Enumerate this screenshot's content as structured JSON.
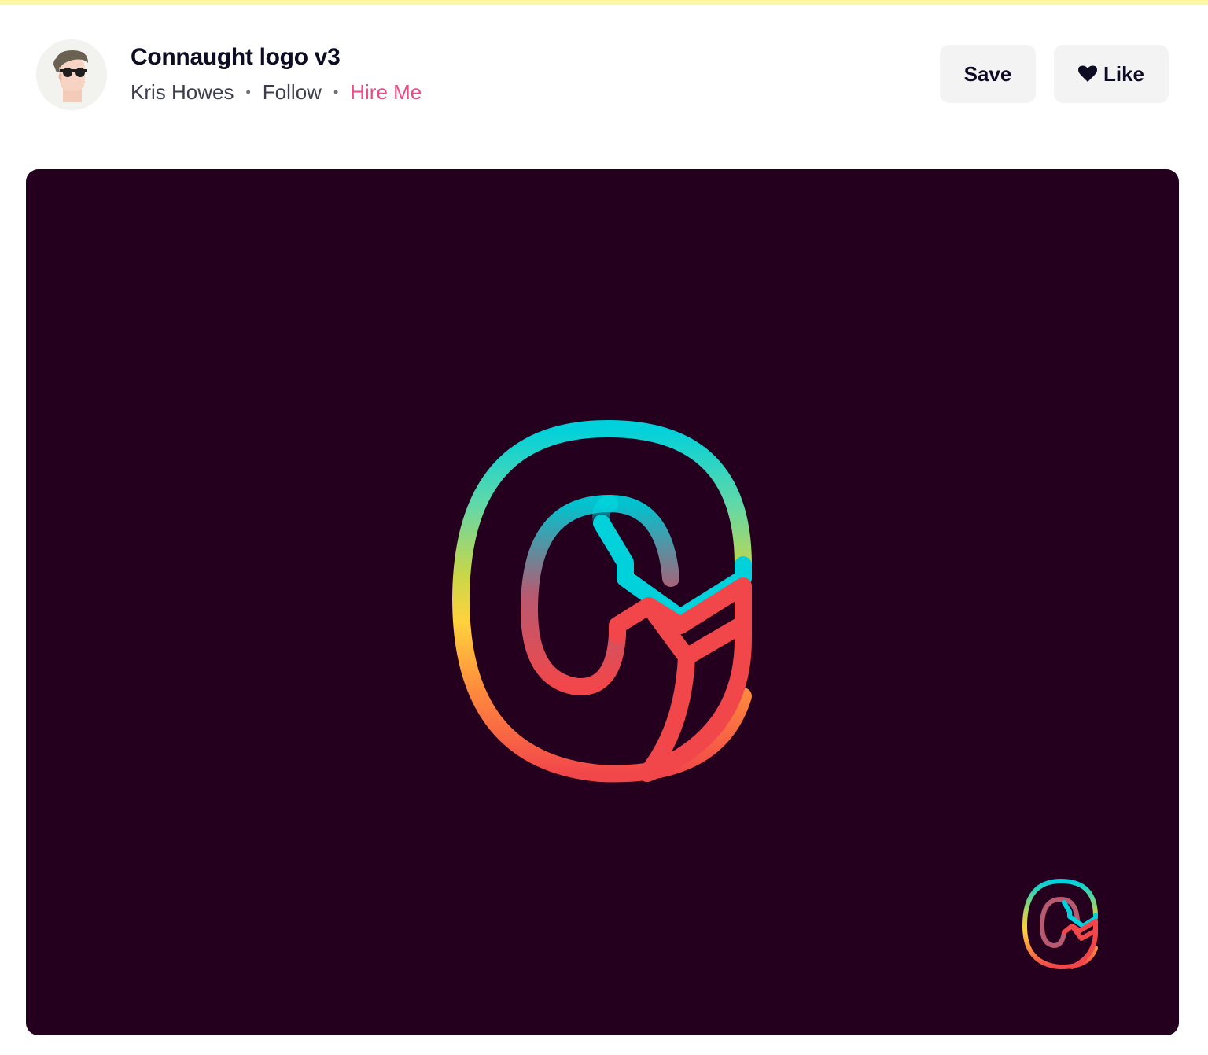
{
  "shot": {
    "title": "Connaught logo v3",
    "designer": "Kris Howes",
    "follow_label": "Follow",
    "hire_label": "Hire Me",
    "separator": "•"
  },
  "actions": {
    "save_label": "Save",
    "like_label": "Like"
  },
  "colors": {
    "top_strip": "#fdf6a3",
    "artwork_background": "#24001e",
    "hire_link": "#ea4c89",
    "logo_cyan": "#00d1db",
    "logo_yellow": "#ffd23d",
    "logo_red": "#f2474a"
  },
  "icons": {
    "like": "heart-icon",
    "avatar": "designer-avatar"
  }
}
